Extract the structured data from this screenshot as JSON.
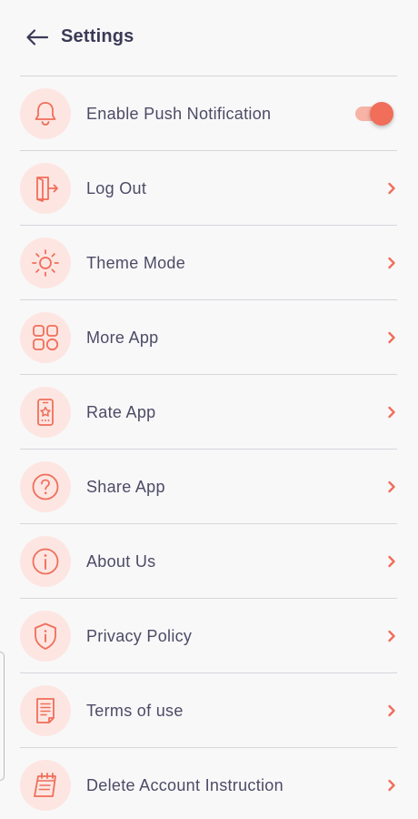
{
  "header": {
    "title": "Settings",
    "back_icon": "arrow-left-icon"
  },
  "colors": {
    "accent": "#f06e5a",
    "icon_bg": "#fde6e2",
    "text": "#4d4b65",
    "title": "#3b3a55",
    "background": "#f8f8f9"
  },
  "settings": {
    "items": [
      {
        "label": "Enable Push Notification",
        "icon": "bell-icon",
        "control": "toggle",
        "toggle_on": true
      },
      {
        "label": "Log Out",
        "icon": "logout-door-icon",
        "control": "chevron"
      },
      {
        "label": "Theme Mode",
        "icon": "sun-icon",
        "control": "chevron"
      },
      {
        "label": "More App",
        "icon": "apps-grid-icon",
        "control": "chevron"
      },
      {
        "label": "Rate App",
        "icon": "phone-star-icon",
        "control": "chevron"
      },
      {
        "label": "Share App",
        "icon": "question-circle-icon",
        "control": "chevron"
      },
      {
        "label": "About Us",
        "icon": "info-circle-icon",
        "control": "chevron"
      },
      {
        "label": "Privacy Policy",
        "icon": "shield-info-icon",
        "control": "chevron"
      },
      {
        "label": "Terms of use",
        "icon": "document-icon",
        "control": "chevron"
      },
      {
        "label": "Delete Account Instruction",
        "icon": "calendar-edit-icon",
        "control": "chevron"
      }
    ]
  }
}
